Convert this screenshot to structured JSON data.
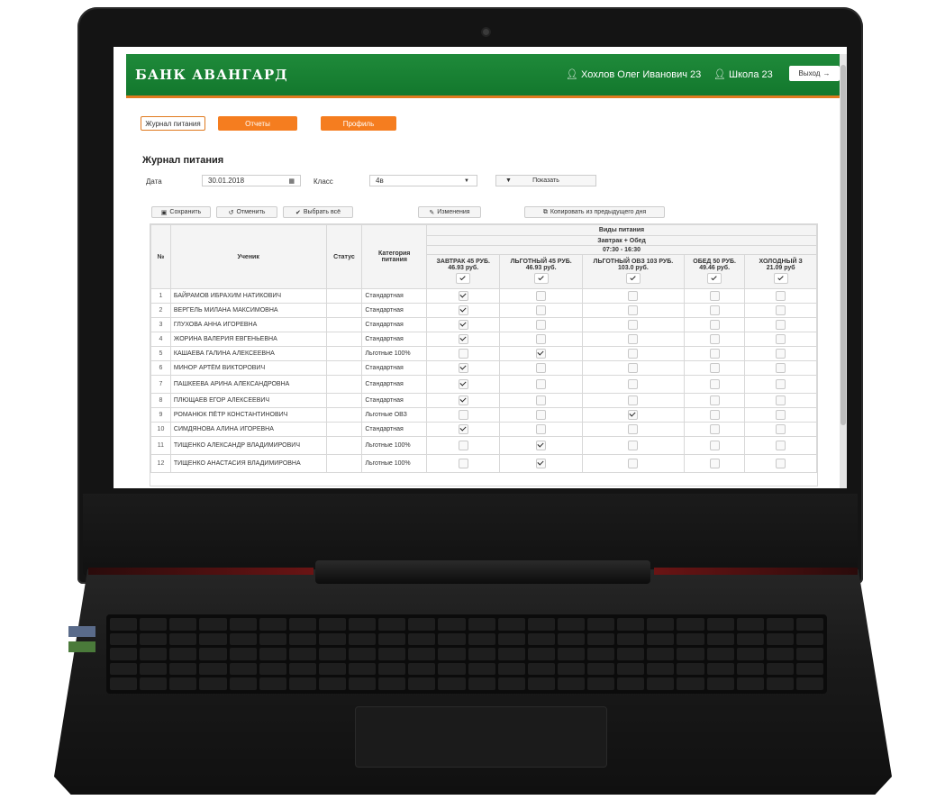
{
  "header": {
    "brand": "БАНК АВАНГАРД",
    "user": "Хохлов Олег Иванович 23",
    "school": "Школа 23",
    "logout_label": "Выход"
  },
  "nav": {
    "tabs": [
      {
        "label": "Журнал питания",
        "active": true
      },
      {
        "label": "Отчеты",
        "active": false
      },
      {
        "label": "Профиль",
        "active": false
      }
    ]
  },
  "page": {
    "title": "Журнал питания",
    "date_label": "Дата",
    "date_value": "30.01.2018",
    "class_label": "Класс",
    "class_value": "4в",
    "show_button": "Показать"
  },
  "toolbar": {
    "save": "Сохранить",
    "cancel": "Отменить",
    "select_all": "Выбрать всё",
    "changes": "Изменения",
    "copy_prev": "Копировать из предыдущего дня"
  },
  "table": {
    "col_num": "№",
    "col_student": "Ученик",
    "col_status": "Статус",
    "col_category": "Категория питания",
    "group_title": "Виды питания",
    "subgroup_title": "Завтрак + Обед",
    "subgroup_time": "07:30 - 16:30",
    "meals": [
      {
        "name": "ЗАВТРАК 45 РУБ.",
        "price": "46.93 руб."
      },
      {
        "name": "ЛЬГОТНЫЙ 45 РУБ.",
        "price": "46.93 руб."
      },
      {
        "name": "ЛЬГОТНЫЙ ОВЗ 103 РУБ.",
        "price": "103.0 руб."
      },
      {
        "name": "ОБЕД 50 РУБ.",
        "price": "49.46 руб."
      },
      {
        "name": "ХОЛОДНЫЙ З",
        "price": "21.09 руб"
      }
    ],
    "rows": [
      {
        "num": "1",
        "name": "БАЙРАМОВ ИБРАХИМ НАТИКОВИЧ",
        "status": "",
        "category": "Стандартная",
        "checks": [
          true,
          false,
          false,
          false,
          false
        ]
      },
      {
        "num": "2",
        "name": "ВЕРГЕЛЬ МИЛАНА МАКСИМОВНА",
        "status": "",
        "category": "Стандартная",
        "checks": [
          true,
          false,
          false,
          false,
          false
        ]
      },
      {
        "num": "3",
        "name": "ГЛУХОВА АННА ИГОРЕВНА",
        "status": "",
        "category": "Стандартная",
        "checks": [
          true,
          false,
          false,
          false,
          false
        ]
      },
      {
        "num": "4",
        "name": "ЖОРИНА ВАЛЕРИЯ ЕВГЕНЬЕВНА",
        "status": "",
        "category": "Стандартная",
        "checks": [
          true,
          false,
          false,
          false,
          false
        ]
      },
      {
        "num": "5",
        "name": "КАШАЕВА ГАЛИНА АЛЕКСЕЕВНА",
        "status": "",
        "category": "Льготные 100%",
        "checks": [
          false,
          true,
          false,
          false,
          false
        ]
      },
      {
        "num": "6",
        "name": "МИНОР АРТЁМ ВИКТОРОВИЧ",
        "status": "",
        "category": "Стандартная",
        "checks": [
          true,
          false,
          false,
          false,
          false
        ]
      },
      {
        "num": "7",
        "name": "ПАШКЕЕВА АРИНА АЛЕКСАНДРОВНА",
        "status": "",
        "category": "Стандартная",
        "checks": [
          true,
          false,
          false,
          false,
          false
        ]
      },
      {
        "num": "8",
        "name": "ПЛЮЩАЕВ ЕГОР АЛЕКСЕЕВИЧ",
        "status": "",
        "category": "Стандартная",
        "checks": [
          true,
          false,
          false,
          false,
          false
        ]
      },
      {
        "num": "9",
        "name": "РОМАНЮК ПЁТР КОНСТАНТИНОВИЧ",
        "status": "",
        "category": "Льготные ОВЗ",
        "checks": [
          false,
          false,
          true,
          false,
          false
        ]
      },
      {
        "num": "10",
        "name": "СИМДЯНОВА АЛИНА ИГОРЕВНА",
        "status": "",
        "category": "Стандартная",
        "checks": [
          true,
          false,
          false,
          false,
          false
        ]
      },
      {
        "num": "11",
        "name": "ТИЩЕНКО АЛЕКСАНДР ВЛАДИМИРОВИЧ",
        "status": "",
        "category": "Льготные 100%",
        "checks": [
          false,
          true,
          false,
          false,
          false
        ]
      },
      {
        "num": "12",
        "name": "ТИЩЕНКО АНАСТАСИЯ ВЛАДИМИРОВНА",
        "status": "",
        "category": "Льготные 100%",
        "checks": [
          false,
          true,
          false,
          false,
          false
        ]
      }
    ]
  },
  "colors": {
    "header_green": "#1a8434",
    "accent_orange": "#f57d1f"
  },
  "icons": {
    "calendar": "calendar-icon",
    "filter": "filter-icon",
    "save": "floppy-icon",
    "cancel": "undo-icon",
    "select_all": "check-icon",
    "changes": "pencil-icon",
    "copy": "copy-icon",
    "user": "user-icon",
    "logout": "logout-icon"
  }
}
